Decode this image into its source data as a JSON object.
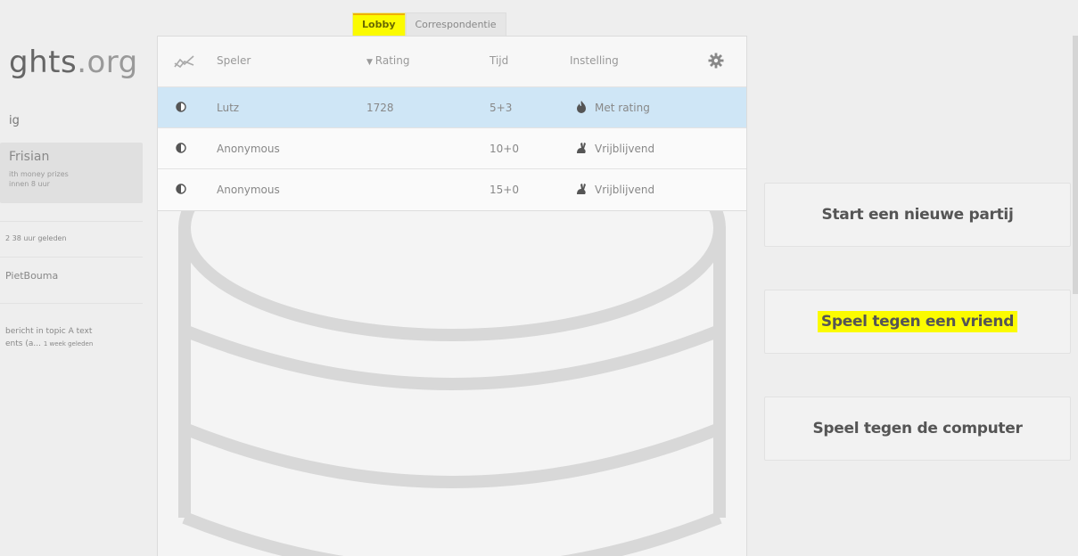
{
  "sidebar": {
    "logo_dark": "ghts",
    "logo_light": ".org",
    "ig_text": "ig",
    "tournament": {
      "name": "Frisian",
      "line1": "ith money prizes",
      "line2": "innen 8 uur"
    },
    "row1": "2 38 uur geleden",
    "row2": "PietBouma",
    "row3_line1": "bericht in topic A text",
    "row3_line2": "ents (a...",
    "row3_time": "1 week geleden"
  },
  "tabs": [
    {
      "label": "Lobby",
      "active": true
    },
    {
      "label": "Correspondentie",
      "active": false
    }
  ],
  "table": {
    "headers": {
      "variant_icon": "chart-icon",
      "player": "Speler",
      "rating": "Rating",
      "time": "Tijd",
      "setting": "Instelling",
      "settings_icon": "gear-icon"
    },
    "rows": [
      {
        "player": "Lutz",
        "rating": "1728",
        "time": "5+3",
        "mode_icon": "fire-icon",
        "setting": "Met rating",
        "selected": true
      },
      {
        "player": "Anonymous",
        "rating": "",
        "time": "10+0",
        "mode_icon": "rabbit-icon",
        "setting": "Vrijblijvend",
        "selected": false
      },
      {
        "player": "Anonymous",
        "rating": "",
        "time": "15+0",
        "mode_icon": "rabbit-icon",
        "setting": "Vrijblijvend",
        "selected": false
      }
    ]
  },
  "actions": {
    "new_game": "Start een nieuwe partij",
    "play_friend": "Speel tegen een vriend",
    "play_computer": "Speel tegen de computer"
  },
  "colors": {
    "highlight": "#fbfb00",
    "selected_row": "#cfe6f6",
    "background": "#eeeeee"
  }
}
